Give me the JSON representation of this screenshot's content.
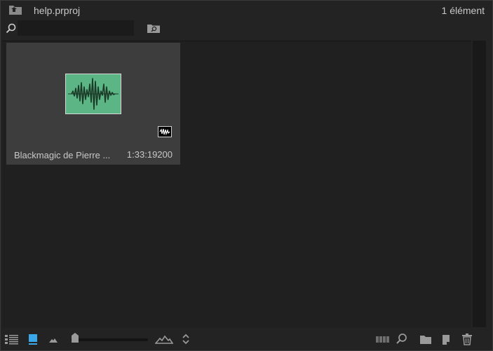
{
  "header": {
    "title": "help.prproj",
    "item_count": "1 élément"
  },
  "search": {
    "value": "",
    "placeholder": ""
  },
  "clips": [
    {
      "name": "Blackmagic de Pierre ...",
      "duration": "1:33:19200"
    }
  ],
  "footer": {
    "zoom_level": 0.05
  },
  "colors": {
    "panel_bg": "#232323",
    "tile_bg": "#3d3d3d",
    "audio_thumb": "#5cb585",
    "accent_blue": "#3aa8e8"
  },
  "icons": [
    "up-folder-icon",
    "search-icon",
    "bin-search-icon",
    "waveform-icon",
    "audio-badge-icon",
    "list-view-icon",
    "icon-view-icon",
    "zoom-out-icon",
    "zoom-in-icon",
    "sort-icon",
    "automate-to-sequence-icon",
    "find-icon",
    "new-bin-icon",
    "new-item-icon",
    "trash-icon"
  ]
}
